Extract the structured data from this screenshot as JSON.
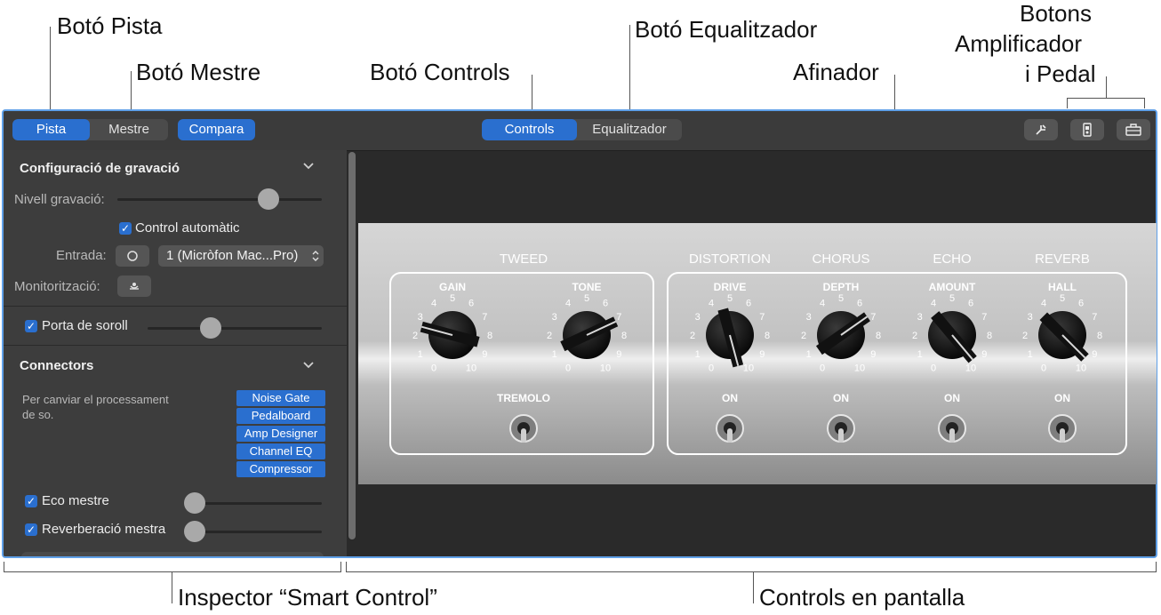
{
  "callouts": {
    "pista": "Botó Pista",
    "mestre": "Botó Mestre",
    "controls": "Botó Controls",
    "eq": "Botó Equalitzador",
    "afinador": "Afinador",
    "amp_line1": "Botons",
    "amp_line2": "Amplificador",
    "amp_line3": "i Pedal",
    "inspector": "Inspector “Smart Control”",
    "onscreen": "Controls en pantalla"
  },
  "toolbar": {
    "track_label": "Pista",
    "master_label": "Mestre",
    "compare_label": "Compara",
    "controls_label": "Controls",
    "eq_label": "Equalitzador"
  },
  "inspector": {
    "rec_title": "Configuració de gravació",
    "rec_level": "Nivell gravació:",
    "auto_control": "Control automàtic",
    "input_label": "Entrada:",
    "input_value": "1 (Micròfon Mac...Pro)",
    "monitoring": "Monitorització:",
    "noise_gate": "Porta de soroll",
    "plugins_title": "Connectors",
    "plugins_desc_1": "Per canviar el processament",
    "plugins_desc_2": "de so.",
    "plugins": [
      "Noise Gate",
      "Pedalboard",
      "Amp Designer",
      "Channel EQ",
      "Compressor"
    ],
    "master_echo": "Eco mestre",
    "master_reverb": "Reverberació mestra"
  },
  "amp": {
    "group1_title": "TWEED",
    "group1_knobs": [
      "GAIN",
      "TONE"
    ],
    "group1_switch": "TREMOLO",
    "effects": [
      {
        "title": "DISTORTION",
        "knob": "DRIVE",
        "switch": "ON"
      },
      {
        "title": "CHORUS",
        "knob": "DEPTH",
        "switch": "ON"
      },
      {
        "title": "ECHO",
        "knob": "AMOUNT",
        "switch": "ON"
      },
      {
        "title": "REVERB",
        "knob": "HALL",
        "switch": "ON"
      }
    ],
    "scale": [
      "0",
      "1",
      "2",
      "3",
      "4",
      "5",
      "6",
      "7",
      "8",
      "9",
      "10"
    ]
  }
}
